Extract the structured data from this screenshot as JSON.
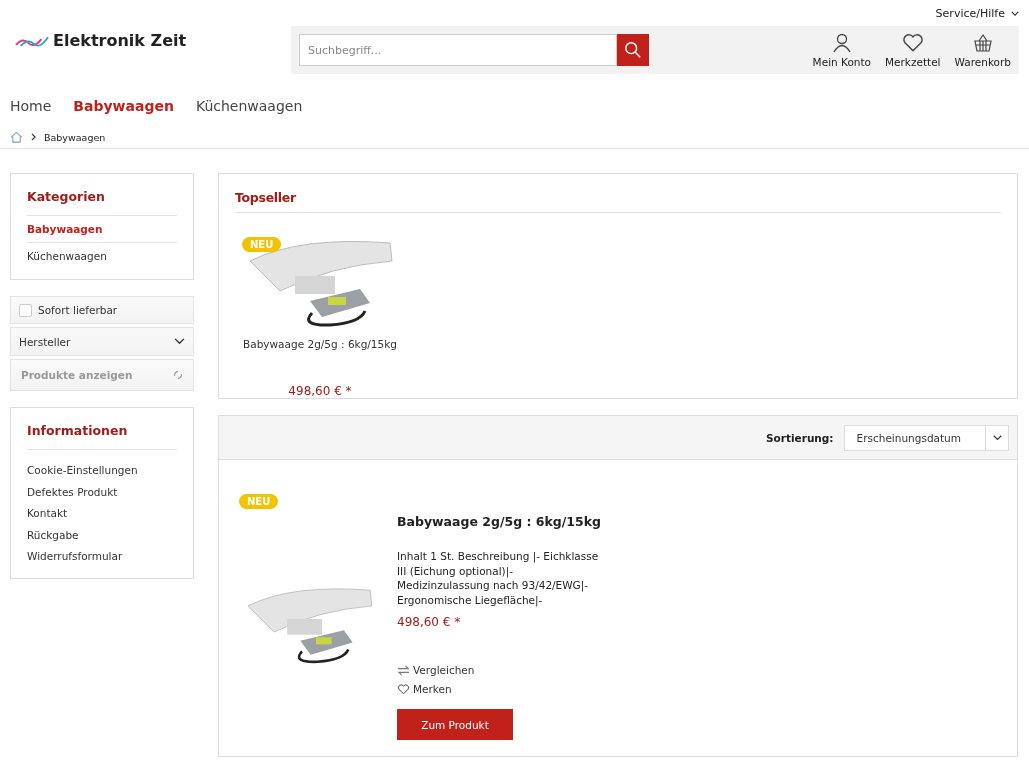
{
  "top_bar": {
    "service_menu": "Service/Hilfe"
  },
  "header": {
    "logo": "Elektronik Zeit",
    "search": {
      "placeholder": "Suchbegriff..."
    },
    "actions": [
      {
        "kind": "account",
        "label": "Mein Konto"
      },
      {
        "kind": "wishlist",
        "label": "Merkzettel"
      },
      {
        "kind": "cart",
        "label": "Warenkorb"
      }
    ]
  },
  "nav": [
    {
      "label": "Home",
      "selected": false
    },
    {
      "label": "Babywaagen",
      "selected": true
    },
    {
      "label": "Küchenwaagen",
      "selected": false
    }
  ],
  "breadcrumb": [
    "Babywaagen"
  ],
  "sidebar": {
    "categories": {
      "title": "Kategorien",
      "items": [
        {
          "label": "Babywaagen",
          "selected": true
        },
        {
          "label": "Küchenwaagen",
          "selected": false
        }
      ]
    },
    "filters": {
      "checkbox": {
        "label": "Sofort lieferbar",
        "checked": false
      },
      "dropdown": "Hersteller",
      "submit": "Produkte anzeigen"
    },
    "info": {
      "title": "Informationen",
      "links": [
        "Cookie-Einstellungen",
        "Defektes Produkt",
        "Kontakt",
        "Rückgabe",
        "Widerrufsformular"
      ]
    }
  },
  "topseller": {
    "title": "Topseller",
    "products": [
      {
        "badge": "NEU",
        "name": "Babywaage 2g/5g : 6kg/15kg",
        "price": "498,60 € *"
      }
    ]
  },
  "listing": {
    "sort_label": "Sortierung:",
    "sort_value": "Erscheinungsdatum",
    "products": [
      {
        "badge": "NEU",
        "name": "Babywaage 2g/5g : 6kg/15kg",
        "description": "Inhalt 1 St. Beschreibung |- Eichklasse III (Eichung optional)|- Medizinzulassung nach 93/42/EWG|- Ergonomische Liegefläche|-",
        "price": "498,60 € *",
        "compare": "Vergleichen",
        "wishlist": "Merken",
        "button": "Zum Produkt"
      }
    ]
  }
}
